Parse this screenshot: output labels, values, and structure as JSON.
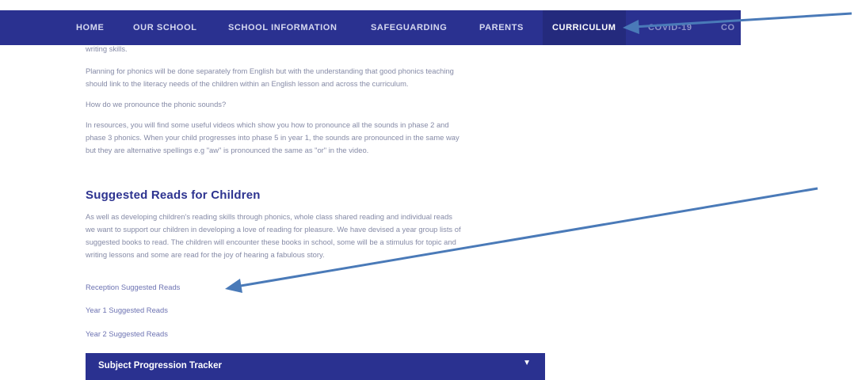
{
  "nav": {
    "items": [
      {
        "label": "HOME"
      },
      {
        "label": "OUR SCHOOL"
      },
      {
        "label": "SCHOOL INFORMATION"
      },
      {
        "label": "SAFEGUARDING"
      },
      {
        "label": "PARENTS"
      },
      {
        "label": "CURRICULUM"
      },
      {
        "label": "COVID-19"
      },
      {
        "label": "CO"
      }
    ]
  },
  "content": {
    "top_fragment": "writing skills.",
    "phonics_para": [
      "Planning for phonics will be done separately from English but with the understanding that good phonics teaching",
      "should link to the literacy needs of the children within an English lesson and across the curriculum."
    ],
    "question": "How do we pronounce the phonic sounds?",
    "resources_para": [
      "In resources, you will find some useful videos which show you how to pronounce all the sounds in phase 2 and",
      "phase 3 phonics. When your child progresses into phase 5 in year 1, the sounds are pronounced in the same way",
      "but they are alternative spellings e.g \"aw\" is pronounced the same as \"or\" in the video."
    ],
    "heading": "Suggested Reads for Children",
    "reads_para": [
      "As well as developing children's reading skills through phonics, whole class shared reading and individual reads",
      "we want to support our children in developing a love of reading for pleasure. We have devised a year group lists of",
      "suggested books to read. The children will encounter these books in school, some will be a stimulus for topic and",
      "writing lessons and some are read for the joy of hearing a fabulous story."
    ],
    "links": [
      {
        "label": "Reception Suggested Reads"
      },
      {
        "label": "Year 1 Suggested Reads"
      },
      {
        "label": "Year 2 Suggested Reads"
      }
    ]
  },
  "accordion": {
    "label": "Subject Progression Tracker"
  },
  "icons": {
    "accordion_chevron": "chevron-down-icon",
    "annotation": "arrow-annotation"
  },
  "colors": {
    "nav_bg": "#2a3190",
    "heading": "#2d3390",
    "arrow": "#4a7ab8"
  }
}
